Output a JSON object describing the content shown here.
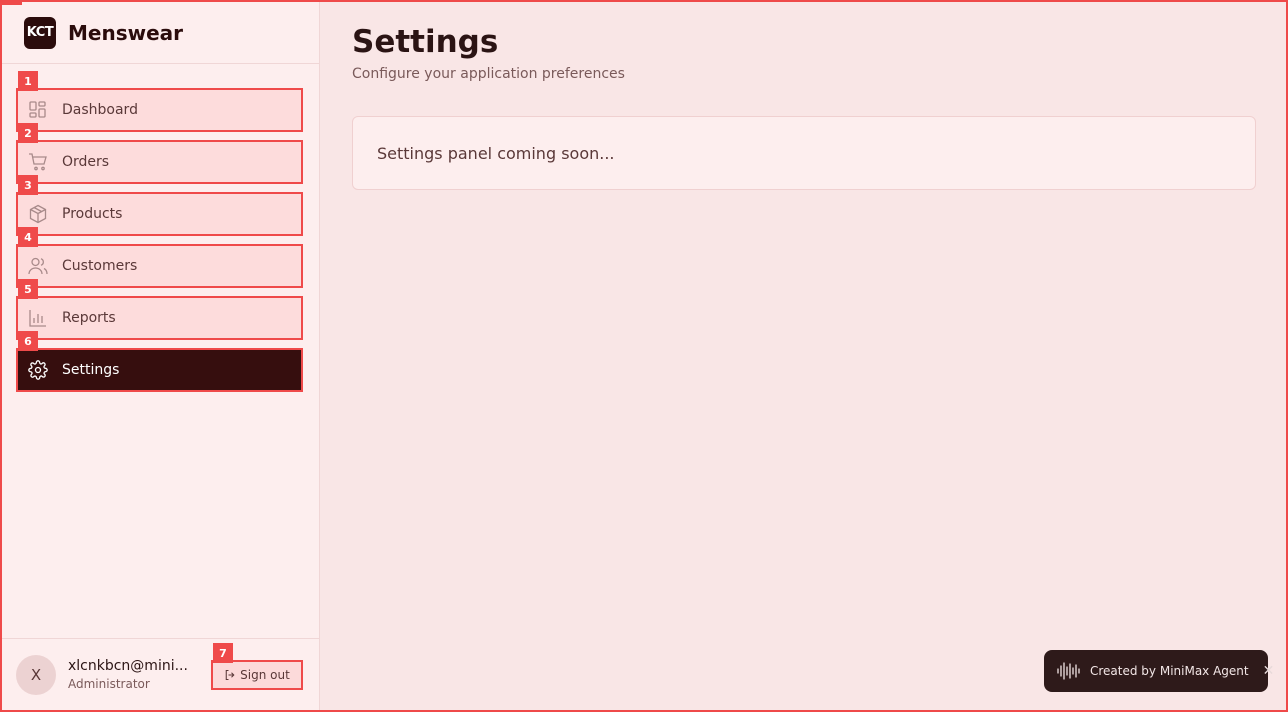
{
  "brand": {
    "logo_text": "KCT",
    "name": "Menswear"
  },
  "nav": {
    "items": [
      {
        "badge": "1",
        "label": "Dashboard",
        "icon": "dashboard-icon"
      },
      {
        "badge": "2",
        "label": "Orders",
        "icon": "cart-icon"
      },
      {
        "badge": "3",
        "label": "Products",
        "icon": "package-icon"
      },
      {
        "badge": "4",
        "label": "Customers",
        "icon": "users-icon"
      },
      {
        "badge": "5",
        "label": "Reports",
        "icon": "bar-chart-icon"
      },
      {
        "badge": "6",
        "label": "Settings",
        "icon": "gear-icon",
        "active": true
      }
    ]
  },
  "user": {
    "initial": "X",
    "email": "xlcnkbcn@mini...",
    "role": "Administrator",
    "signout_badge": "7",
    "signout_label": "Sign out"
  },
  "main": {
    "title": "Settings",
    "subtitle": "Configure your application preferences",
    "panel_text": "Settings panel coming soon..."
  },
  "toast": {
    "text": "Created by MiniMax Agent",
    "close": "✕"
  },
  "colors": {
    "accent": "#ef4a4a",
    "active_bg": "#360e0e",
    "page_bg": "#f9e6e6",
    "sidebar_bg": "#fdeeee"
  }
}
